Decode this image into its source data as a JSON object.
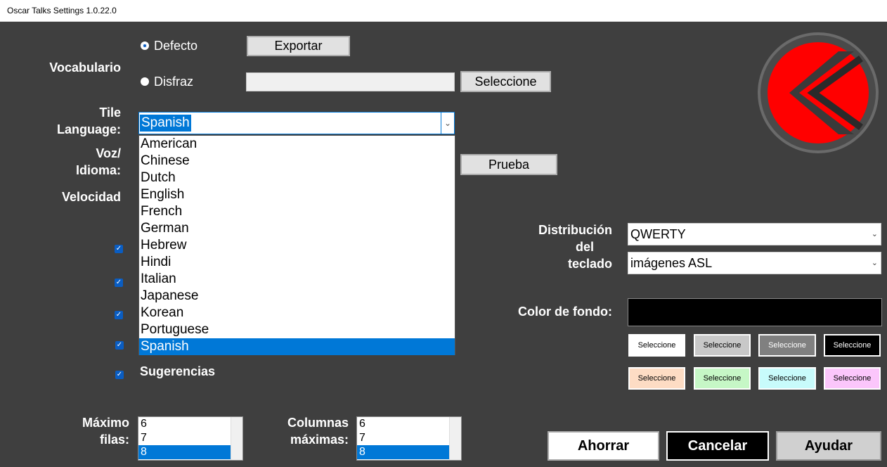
{
  "window": {
    "title": "Oscar Talks Settings 1.0.22.0"
  },
  "vocab": {
    "label": "Vocabulario",
    "option_default": "Defecto",
    "option_custom": "Disfraz",
    "export_button": "Exportar",
    "select_button": "Seleccione",
    "custom_path": ""
  },
  "tile_language": {
    "label_line1": "Tile",
    "label_line2": "Language:",
    "selected": "Spanish",
    "options": [
      "American",
      "Chinese",
      "Dutch",
      "English",
      "French",
      "German",
      "Hebrew",
      "Hindi",
      "Italian",
      "Japanese",
      "Korean",
      "Portuguese",
      "Spanish"
    ]
  },
  "voice": {
    "label_line1": "Voz/",
    "label_line2": "Idioma:",
    "test_button": "Prueba"
  },
  "speed": {
    "label": "Velocidad"
  },
  "checkboxes": {
    "suggestions_label": "Sugerencias"
  },
  "keyboard": {
    "label_line1": "Distribución",
    "label_line2": "del",
    "label_line3": "teclado",
    "layout_value": "QWERTY",
    "images_value": "imágenes ASL"
  },
  "background": {
    "label": "Color de fondo:",
    "current_color": "#000000",
    "swatch_label": "Seleccione",
    "swatch_colors": [
      "#ffffff",
      "#c8c8c8",
      "#808080",
      "#000000",
      "#fddcc4",
      "#c6f7c6",
      "#c8fbfb",
      "#fbc6fb"
    ]
  },
  "max_rows": {
    "label_line1": "Máximo",
    "label_line2": "filas:",
    "items": [
      "6",
      "7",
      "8"
    ],
    "selected": "8"
  },
  "max_cols": {
    "label_line1": "Columnas",
    "label_line2": "máximas:",
    "items": [
      "6",
      "7",
      "8"
    ],
    "selected": "8"
  },
  "actions": {
    "save": "Ahorrar",
    "cancel": "Cancelar",
    "help": "Ayudar"
  },
  "colors": {
    "accent": "#0078d7",
    "panel": "#3f3f3f",
    "logo_red": "#ff0000"
  }
}
